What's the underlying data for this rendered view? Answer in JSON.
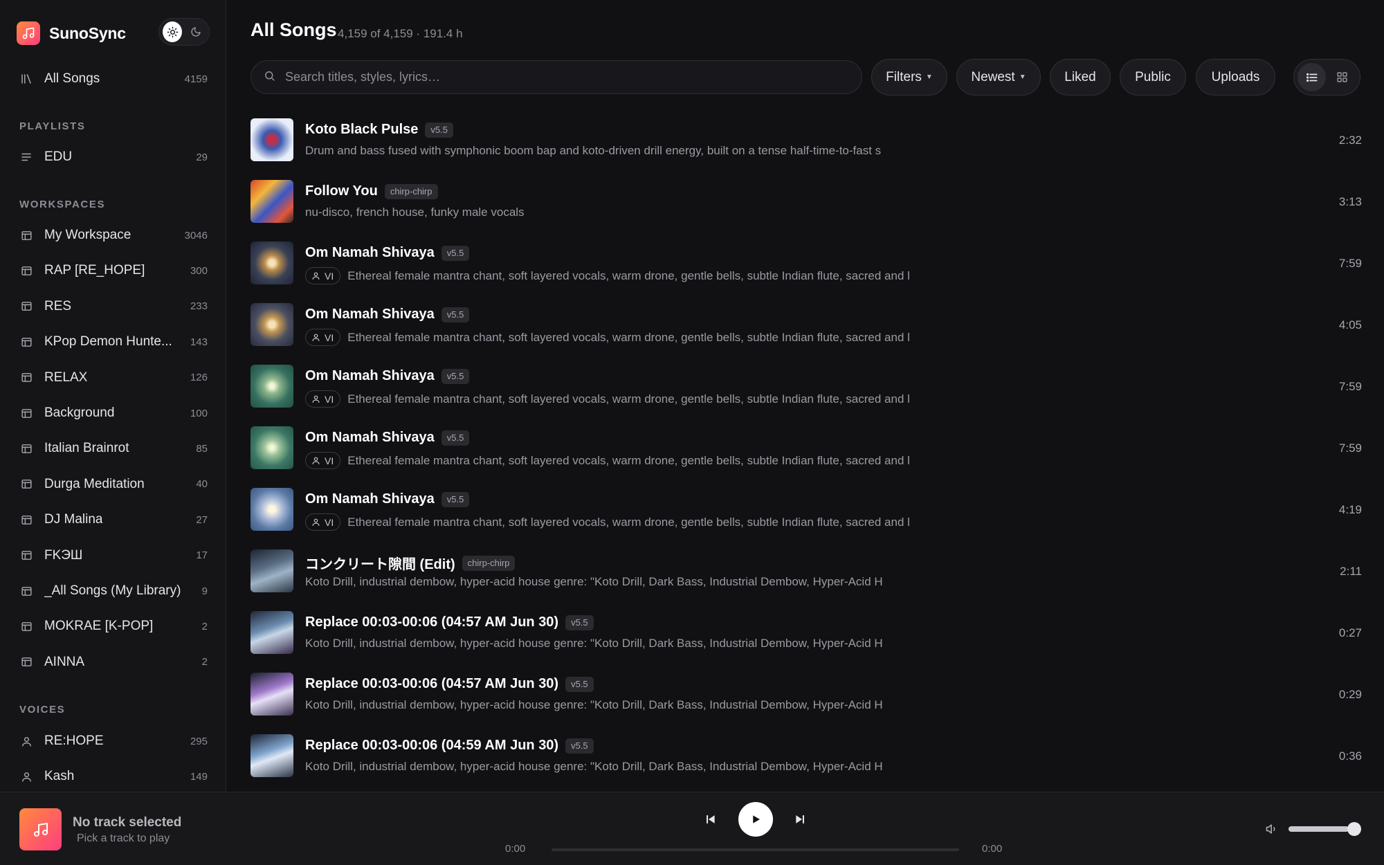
{
  "brand": {
    "name": "SunoSync"
  },
  "sidebar": {
    "all_songs": {
      "label": "All Songs",
      "count": "4159"
    },
    "playlists_label": "PLAYLISTS",
    "playlists": [
      {
        "label": "EDU",
        "count": "29"
      }
    ],
    "workspaces_label": "WORKSPACES",
    "workspaces": [
      {
        "label": "My Workspace",
        "count": "3046"
      },
      {
        "label": "RAP [RE_HOPE]",
        "count": "300"
      },
      {
        "label": "RES",
        "count": "233"
      },
      {
        "label": "KPop Demon Hunte...",
        "count": "143"
      },
      {
        "label": "RELAX",
        "count": "126"
      },
      {
        "label": "Background",
        "count": "100"
      },
      {
        "label": "Italian Brainrot",
        "count": "85"
      },
      {
        "label": "Durga Meditation",
        "count": "40"
      },
      {
        "label": "DJ Malina",
        "count": "27"
      },
      {
        "label": "FKЭШ",
        "count": "17"
      },
      {
        "label": "_All Songs (My Library)",
        "count": "9"
      },
      {
        "label": "MOKRAE [K-POP]",
        "count": "2"
      },
      {
        "label": "AINNA",
        "count": "2"
      }
    ],
    "voices_label": "VOICES",
    "voices": [
      {
        "label": "RE:HOPE",
        "count": "295"
      },
      {
        "label": "Kash",
        "count": "149"
      }
    ]
  },
  "header": {
    "title": "All Songs",
    "meta": "4,159 of 4,159 · 191.4 h"
  },
  "search": {
    "placeholder": "Search titles, styles, lyrics…"
  },
  "toolbar": {
    "filters": "Filters",
    "sort": "Newest",
    "liked": "Liked",
    "public": "Public",
    "uploads": "Uploads"
  },
  "songs": [
    {
      "title": "Koto Black Pulse",
      "version": "v5.5",
      "voice": "",
      "desc": "Drum and bass fused with symphonic boom bap and koto-driven drill energy, built on a tense half-time-to-fast s",
      "duration": "2:32"
    },
    {
      "title": "Follow You",
      "version": "chirp-chirp",
      "voice": "",
      "desc": "nu-disco, french house, funky male vocals",
      "duration": "3:13"
    },
    {
      "title": "Om Namah Shivaya",
      "version": "v5.5",
      "voice": "VI",
      "desc": "Ethereal female mantra chant, soft layered vocals, warm drone, gentle bells, subtle Indian flute, sacred and l",
      "duration": "7:59"
    },
    {
      "title": "Om Namah Shivaya",
      "version": "v5.5",
      "voice": "VI",
      "desc": "Ethereal female mantra chant, soft layered vocals, warm drone, gentle bells, subtle Indian flute, sacred and l",
      "duration": "4:05"
    },
    {
      "title": "Om Namah Shivaya",
      "version": "v5.5",
      "voice": "VI",
      "desc": "Ethereal female mantra chant, soft layered vocals, warm drone, gentle bells, subtle Indian flute, sacred and l",
      "duration": "7:59"
    },
    {
      "title": "Om Namah Shivaya",
      "version": "v5.5",
      "voice": "VI",
      "desc": "Ethereal female mantra chant, soft layered vocals, warm drone, gentle bells, subtle Indian flute, sacred and l",
      "duration": "7:59"
    },
    {
      "title": "Om Namah Shivaya",
      "version": "v5.5",
      "voice": "VI",
      "desc": "Ethereal female mantra chant, soft layered vocals, warm drone, gentle bells, subtle Indian flute, sacred and l",
      "duration": "4:19"
    },
    {
      "title": "コンクリート隙間 (Edit)",
      "version": "chirp-chirp",
      "voice": "",
      "desc": "Koto Drill, industrial dembow, hyper-acid house genre: \"Koto Drill, Dark Bass, Industrial Dembow, Hyper-Acid H",
      "duration": "2:11"
    },
    {
      "title": "Replace 00:03-00:06 (04:57 AM Jun 30)",
      "version": "v5.5",
      "voice": "",
      "desc": "Koto Drill, industrial dembow, hyper-acid house genre: \"Koto Drill, Dark Bass, Industrial Dembow, Hyper-Acid H",
      "duration": "0:27"
    },
    {
      "title": "Replace 00:03-00:06 (04:57 AM Jun 30)",
      "version": "v5.5",
      "voice": "",
      "desc": "Koto Drill, industrial dembow, hyper-acid house genre: \"Koto Drill, Dark Bass, Industrial Dembow, Hyper-Acid H",
      "duration": "0:29"
    },
    {
      "title": "Replace 00:03-00:06 (04:59 AM Jun 30)",
      "version": "v5.5",
      "voice": "",
      "desc": "Koto Drill, industrial dembow, hyper-acid house genre: \"Koto Drill, Dark Bass, Industrial Dembow, Hyper-Acid H",
      "duration": "0:36"
    }
  ],
  "player": {
    "title": "No track selected",
    "subtitle": "Pick a track to play",
    "time_current": "0:00",
    "time_total": "0:00",
    "volume": 0.85
  },
  "colors": {
    "background": "#111114",
    "sidebar": "#151518",
    "accent_start": "#ff8a3d",
    "accent_end": "#ff3d7f"
  }
}
